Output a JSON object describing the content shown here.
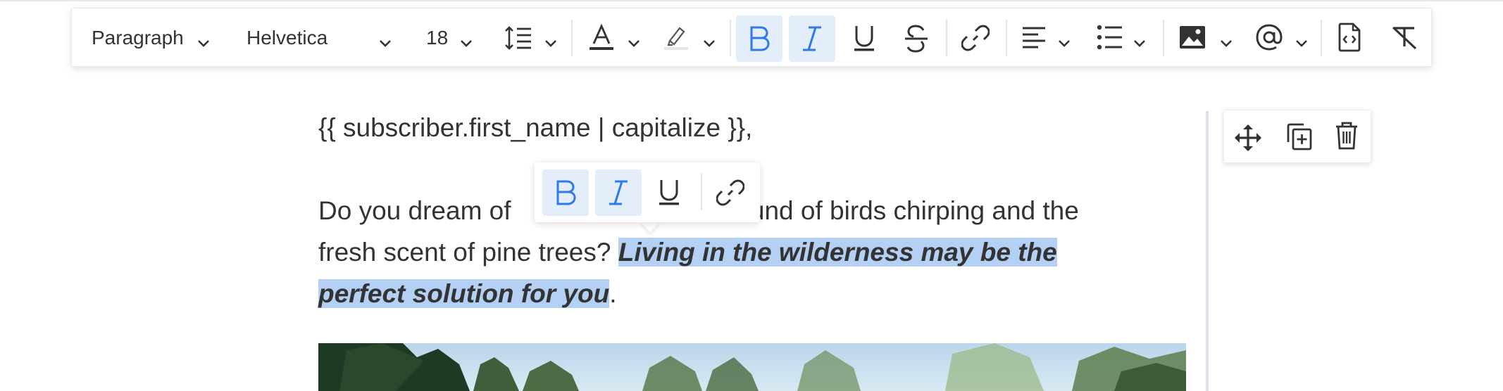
{
  "toolbar": {
    "block_format": "Paragraph",
    "font_family": "Helvetica",
    "font_size": "18",
    "colors": {
      "active_bg": "#e4edfa",
      "active_icon": "#2f79e8",
      "icon": "#333333"
    }
  },
  "editor": {
    "greeting": "{{ subscriber.first_name | capitalize }},",
    "para_line1_before": "Do you dream of ",
    "para_line1_after": "sound of birds chirping and the",
    "para_line2_plain": "fresh scent of pine trees? ",
    "para_line2_selected": "Living in the wilderness may be the",
    "para_line3_selected": "perfect solution for you",
    "para_line3_tail": "."
  },
  "icons": {
    "line_height": "line-height-icon",
    "text_color": "text-color-icon",
    "highlight": "highlight-icon",
    "bold": "bold-icon",
    "italic": "italic-icon",
    "underline": "underline-icon",
    "strikethrough": "strikethrough-icon",
    "link": "link-icon",
    "align": "align-left-icon",
    "list": "bullet-list-icon",
    "image": "image-icon",
    "mention": "at-mention-icon",
    "source": "source-code-icon",
    "clear": "clear-format-icon",
    "move": "move-icon",
    "duplicate": "duplicate-icon",
    "delete": "trash-icon"
  }
}
